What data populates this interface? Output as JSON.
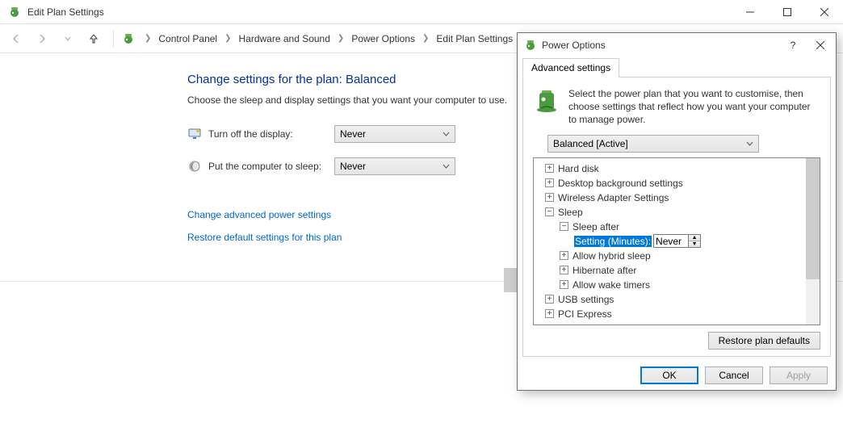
{
  "window": {
    "title": "Edit Plan Settings"
  },
  "breadcrumb": {
    "items": [
      "Control Panel",
      "Hardware and Sound",
      "Power Options",
      "Edit Plan Settings"
    ]
  },
  "page": {
    "title": "Change settings for the plan: Balanced",
    "description": "Choose the sleep and display settings that you want your computer to use.",
    "display_label": "Turn off the display:",
    "display_value": "Never",
    "sleep_label": "Put the computer to sleep:",
    "sleep_value": "Never",
    "link_advanced": "Change advanced power settings",
    "link_restore": "Restore default settings for this plan"
  },
  "dialog": {
    "title": "Power Options",
    "tab": "Advanced settings",
    "info": "Select the power plan that you want to customise, then choose settings that reflect how you want your computer to manage power.",
    "plan_value": "Balanced [Active]",
    "tree": {
      "hard_disk": "Hard disk",
      "desktop_bg": "Desktop background settings",
      "wireless": "Wireless Adapter Settings",
      "sleep": "Sleep",
      "sleep_after": "Sleep after",
      "setting_label": "Setting (Minutes):",
      "setting_value": "Never",
      "allow_hybrid": "Allow hybrid sleep",
      "hibernate_after": "Hibernate after",
      "allow_wake": "Allow wake timers",
      "usb": "USB settings",
      "pci": "PCI Express"
    },
    "restore_button": "Restore plan defaults",
    "ok": "OK",
    "cancel": "Cancel",
    "apply": "Apply"
  }
}
